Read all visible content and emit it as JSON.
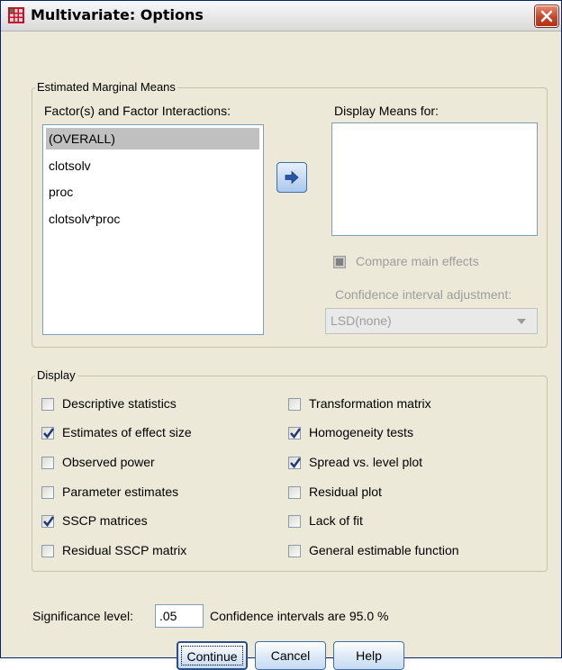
{
  "window": {
    "title": "Multivariate: Options"
  },
  "estimated_marginal_means": {
    "group_label": "Estimated Marginal Means",
    "factors_label": "Factor(s) and Factor Interactions:",
    "factors": [
      "(OVERALL)",
      "clotsolv",
      "proc",
      "clotsolv*proc"
    ],
    "selected_factor": "(OVERALL)",
    "display_means_label": "Display Means for:",
    "display_means_items": [],
    "compare_main_effects": {
      "label": "Compare main effects",
      "checked": false,
      "enabled": false
    },
    "ci_adjustment": {
      "label": "Confidence interval adjustment:",
      "value": "LSD(none)",
      "enabled": false
    }
  },
  "display": {
    "group_label": "Display",
    "left_options": [
      {
        "label": "Descriptive statistics",
        "checked": false
      },
      {
        "label": "Estimates of effect size",
        "checked": true
      },
      {
        "label": "Observed power",
        "checked": false
      },
      {
        "label": "Parameter estimates",
        "checked": false
      },
      {
        "label": "SSCP matrices",
        "checked": true
      },
      {
        "label": "Residual SSCP matrix",
        "checked": false
      }
    ],
    "right_options": [
      {
        "label": "Transformation matrix",
        "checked": false
      },
      {
        "label": "Homogeneity tests",
        "checked": true
      },
      {
        "label": "Spread vs. level plot",
        "checked": true
      },
      {
        "label": "Residual plot",
        "checked": false
      },
      {
        "label": "Lack of fit",
        "checked": false
      },
      {
        "label": "General estimable function",
        "checked": false
      }
    ]
  },
  "significance": {
    "label": "Significance level:",
    "value": ".05",
    "ci_text": "Confidence intervals are 95.0 %"
  },
  "buttons": {
    "continue": "Continue",
    "cancel": "Cancel",
    "help": "Help"
  },
  "colors": {
    "accent": "#3f6ea8",
    "selection": "#c0c0c0",
    "check": "#21387a",
    "dialog_bg": "#ece9d8"
  }
}
